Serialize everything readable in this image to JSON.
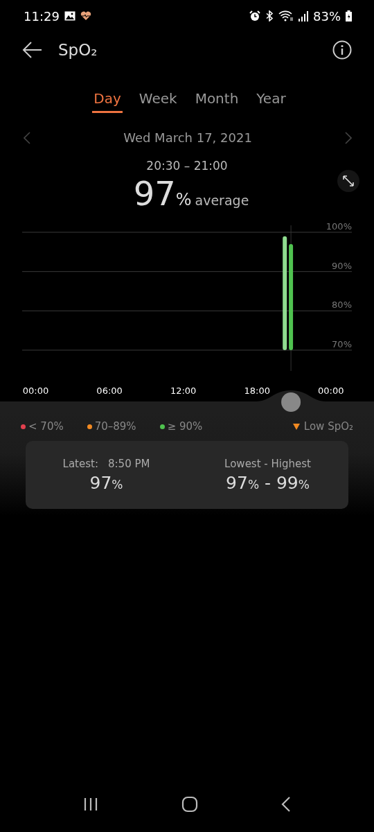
{
  "status_bar": {
    "time": "11:29",
    "battery": "83%"
  },
  "header": {
    "title": "SpO₂"
  },
  "tabs": [
    {
      "label": "Day",
      "selected": true
    },
    {
      "label": "Week",
      "selected": false
    },
    {
      "label": "Month",
      "selected": false
    },
    {
      "label": "Year",
      "selected": false
    }
  ],
  "date": "Wed March 17, 2021",
  "summary": {
    "range": "20:30 – 21:00",
    "number": "97",
    "unit": "%",
    "caption": "average"
  },
  "chart": {
    "chart_data": {
      "type": "bar",
      "x": [
        20.25,
        20.75
      ],
      "values": [
        99,
        97
      ],
      "xlim": [
        -1.1,
        25.7
      ],
      "ylim": [
        70,
        100
      ],
      "ref_lines": [
        {
          "axis": "x",
          "value": 20.75
        }
      ],
      "xticks": [
        {
          "value": 0,
          "label": "00:00"
        },
        {
          "value": 6,
          "label": "06:00"
        },
        {
          "value": 12,
          "label": "12:00"
        },
        {
          "value": 18,
          "label": "18:00"
        },
        {
          "value": 24,
          "label": "00:00"
        }
      ],
      "yticks": [
        {
          "value": 100,
          "label": "100%"
        },
        {
          "value": 90,
          "label": "90%"
        },
        {
          "value": 80,
          "label": "80%"
        },
        {
          "value": 70,
          "label": "70%"
        }
      ]
    }
  },
  "legend": [
    {
      "label": "< 70%",
      "color": "#e2404e"
    },
    {
      "label": "70–89%",
      "color": "#f28a22"
    },
    {
      "label": "≥ 90%",
      "color": "#4fc24f"
    }
  ],
  "low_marker": {
    "label": "Low SpO₂"
  },
  "stats": [
    {
      "label": "Latest:",
      "time": "8:50 PM",
      "values": [
        {
          "number": "97",
          "unit": "%"
        }
      ]
    },
    {
      "label": "Lowest - Highest",
      "values": [
        {
          "number": "97",
          "unit": "%"
        },
        {
          "number": "99",
          "unit": "%"
        }
      ],
      "separator": "-"
    }
  ]
}
